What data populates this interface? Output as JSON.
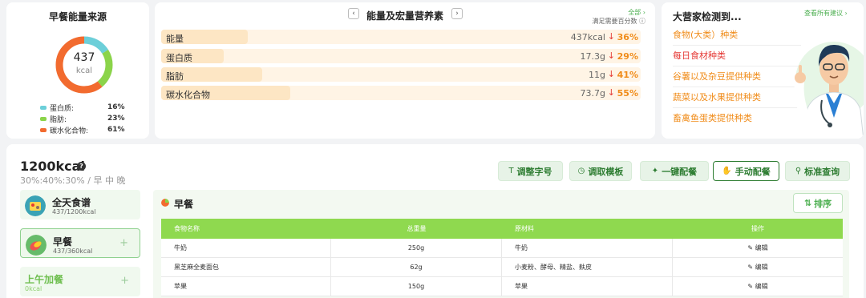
{
  "energy_source": {
    "title": "早餐能量来源",
    "total": "437",
    "unit": "kcal",
    "legend": [
      {
        "label": "蛋白质:",
        "value": "16%",
        "color": "#6ccfd9"
      },
      {
        "label": "脂肪:",
        "value": "23%",
        "color": "#8bd44a"
      },
      {
        "label": "碳水化合物:",
        "value": "61%",
        "color": "#f26b2f"
      }
    ]
  },
  "nutrients": {
    "title": "能量及宏量营养素",
    "all_label": "全部",
    "note": "满足需要百分数",
    "rows": [
      {
        "label": "能量",
        "amount": "437kcal",
        "percent": "36%",
        "level": 0.18
      },
      {
        "label": "蛋白质",
        "amount": "17.3g",
        "percent": "29%",
        "level": 0.13
      },
      {
        "label": "脂肪",
        "amount": "11g",
        "percent": "41%",
        "level": 0.21
      },
      {
        "label": "碳水化合物",
        "amount": "73.7g",
        "percent": "55%",
        "level": 0.27
      }
    ]
  },
  "expert": {
    "title": "大营家检测到...",
    "all_label": "查看所有建议",
    "suggestions": [
      {
        "text": "食物(大类）种类",
        "color": "#f08c1a"
      },
      {
        "text": "每日食材种类",
        "color": "#e53935"
      },
      {
        "text": "谷薯以及杂豆提供种类",
        "color": "#f08c1a"
      },
      {
        "text": "蔬菜以及水果提供种类",
        "color": "#f08c1a"
      },
      {
        "text": "畜禽鱼蛋类提供种类",
        "color": "#f08c1a"
      }
    ]
  },
  "plan": {
    "kcal": "1200kcal",
    "help": "?",
    "ratio": "30%:40%:30% / 早 中 晚"
  },
  "toolbar": {
    "font_size": "调整字号",
    "template": "调取模板",
    "one_click": "一键配餐",
    "manual": "手动配餐",
    "standard": "标准查询"
  },
  "meals": [
    {
      "name": "全天食谱",
      "kcal": "437/1200kcal"
    },
    {
      "name": "早餐",
      "kcal": "437/360kcal"
    },
    {
      "name": "上午加餐",
      "kcal": "0kcal"
    }
  ],
  "detail": {
    "title": "早餐",
    "sort_label": "排序",
    "headers": [
      "食物名称",
      "总重量",
      "原材料",
      "操作"
    ],
    "rows": [
      {
        "name": "牛奶",
        "weight": "250g",
        "ingredients": "牛奶",
        "action": "编辑"
      },
      {
        "name": "黑芝麻全麦面包",
        "weight": "62g",
        "ingredients": "小麦粉、酵母、精盐、麸皮",
        "action": "编辑"
      },
      {
        "name": "苹果",
        "weight": "150g",
        "ingredients": "苹果",
        "action": "编辑"
      }
    ]
  }
}
